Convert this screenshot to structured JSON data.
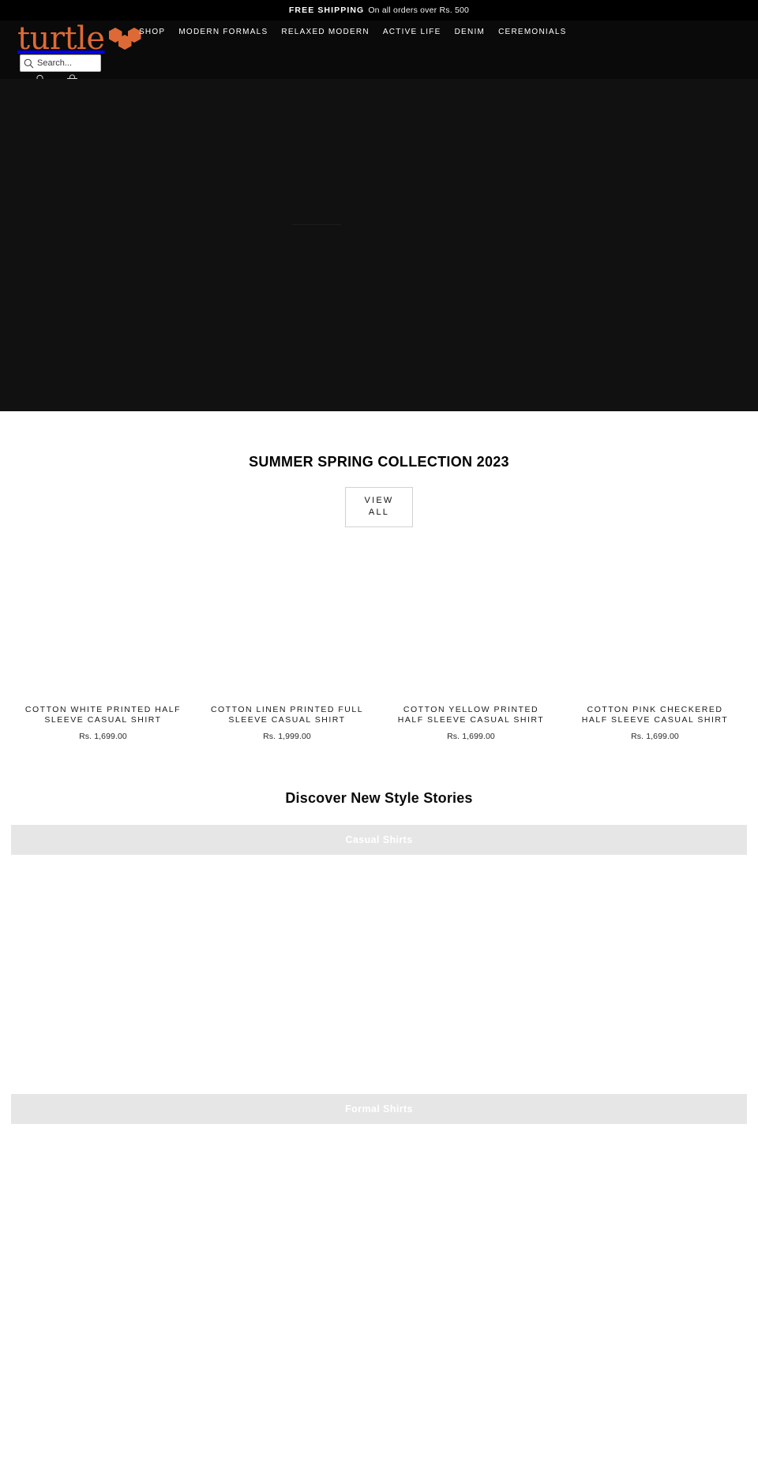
{
  "announcement": {
    "strong": "FREE SHIPPING",
    "rest": "On all orders over Rs. 500"
  },
  "header": {
    "logo_text": "turtle",
    "logo_icon": "hexagon-cluster-icon",
    "nav": [
      {
        "label": "SHOP"
      },
      {
        "label": "MODERN FORMALS"
      },
      {
        "label": "RELAXED MODERN"
      },
      {
        "label": "ACTIVE LIFE"
      },
      {
        "label": "DENIM"
      },
      {
        "label": "CEREMONIALS"
      }
    ],
    "search": {
      "placeholder": "Search...",
      "value": ""
    },
    "account_icon": "user-icon",
    "cart_icon": "shopping-bag-icon"
  },
  "collection": {
    "title": "SUMMER SPRING COLLECTION 2023",
    "view_all_line1": "VIEW",
    "view_all_line2": "ALL",
    "products": [
      {
        "title": "COTTON WHITE PRINTED HALF SLEEVE CASUAL SHIRT",
        "price": "Rs. 1,699.00"
      },
      {
        "title": "COTTON LINEN PRINTED FULL SLEEVE CASUAL SHIRT",
        "price": "Rs. 1,999.00"
      },
      {
        "title": "COTTON YELLOW PRINTED HALF SLEEVE CASUAL SHIRT",
        "price": "Rs. 1,699.00"
      },
      {
        "title": "COTTON PINK CHECKERED HALF SLEEVE CASUAL SHIRT",
        "price": "Rs. 1,699.00"
      }
    ]
  },
  "stories": {
    "title": "Discover New Style Stories",
    "banners": [
      {
        "label": "Casual Shirts"
      },
      {
        "label": "Formal Shirts"
      }
    ]
  },
  "colors": {
    "brand_orange": "#dd6a36",
    "header_black": "#0a0a0a",
    "hero_black": "#111111",
    "banner_grey": "#e6e6e6"
  }
}
